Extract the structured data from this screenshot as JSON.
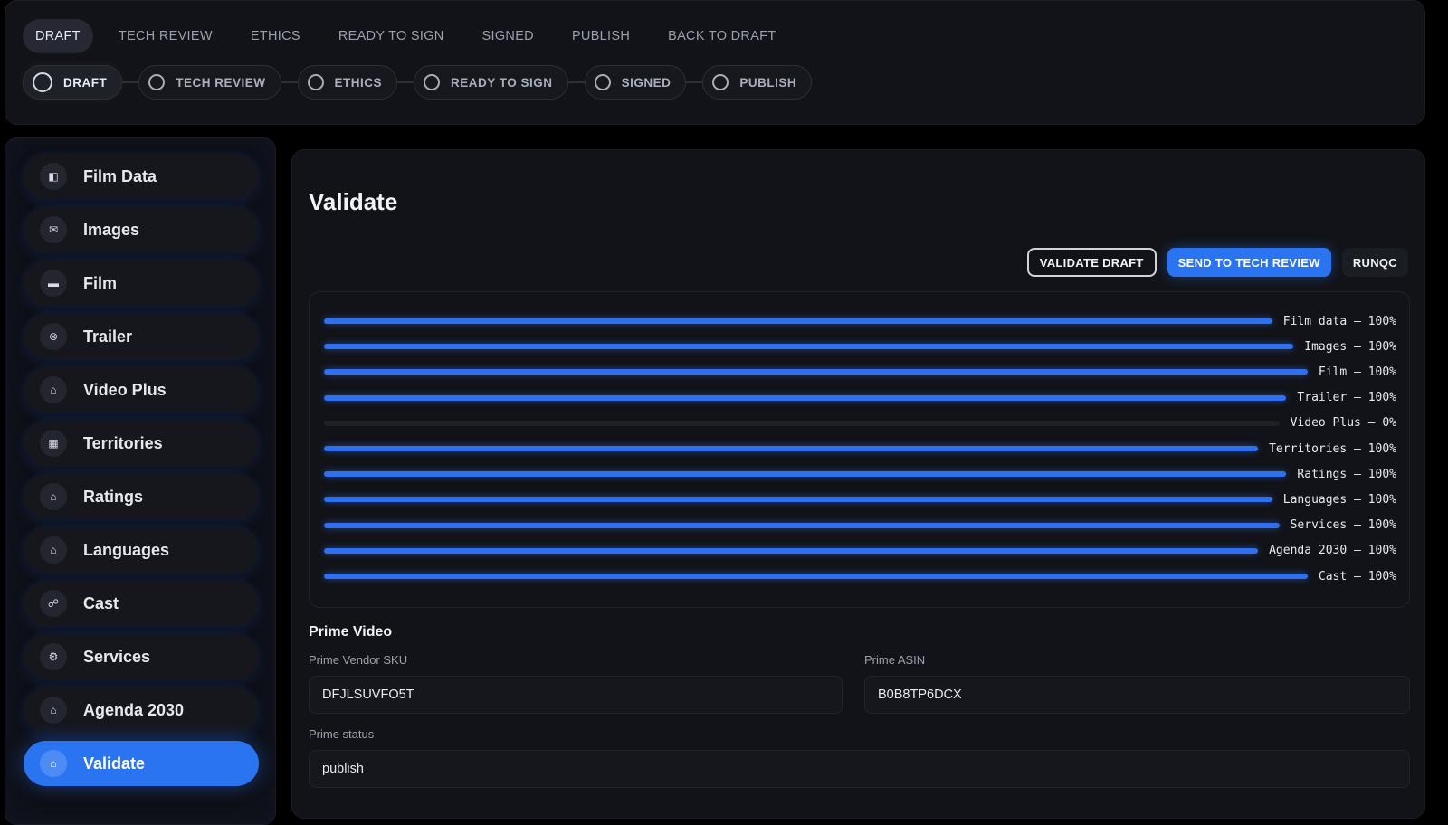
{
  "tabs": [
    {
      "label": "DRAFT",
      "active": true
    },
    {
      "label": "TECH REVIEW",
      "active": false
    },
    {
      "label": "ETHICS",
      "active": false
    },
    {
      "label": "READY TO SIGN",
      "active": false
    },
    {
      "label": "SIGNED",
      "active": false
    },
    {
      "label": "PUBLISH",
      "active": false
    },
    {
      "label": "BACK TO DRAFT",
      "active": false
    }
  ],
  "steps": [
    {
      "label": "DRAFT",
      "active": true
    },
    {
      "label": "TECH REVIEW",
      "active": false
    },
    {
      "label": "ETHICS",
      "active": false
    },
    {
      "label": "READY TO SIGN",
      "active": false
    },
    {
      "label": "SIGNED",
      "active": false
    },
    {
      "label": "PUBLISH",
      "active": false
    }
  ],
  "sidebar": {
    "items": [
      {
        "label": "Film Data",
        "icon": "film-data-icon",
        "glyph": "◧"
      },
      {
        "label": "Images",
        "icon": "images-icon",
        "glyph": "✉"
      },
      {
        "label": "Film",
        "icon": "film-icon",
        "glyph": "▬"
      },
      {
        "label": "Trailer",
        "icon": "trailer-icon",
        "glyph": "⊗"
      },
      {
        "label": "Video Plus",
        "icon": "home-icon",
        "glyph": "⌂"
      },
      {
        "label": "Territories",
        "icon": "calendar-icon",
        "glyph": "▦"
      },
      {
        "label": "Ratings",
        "icon": "home-icon",
        "glyph": "⌂"
      },
      {
        "label": "Languages",
        "icon": "home-icon",
        "glyph": "⌂"
      },
      {
        "label": "Cast",
        "icon": "users-icon",
        "glyph": "☍"
      },
      {
        "label": "Services",
        "icon": "gear-icon",
        "glyph": "⚙"
      },
      {
        "label": "Agenda 2030",
        "icon": "home-icon",
        "glyph": "⌂"
      },
      {
        "label": "Validate",
        "icon": "home-icon",
        "glyph": "⌂",
        "active": true
      }
    ]
  },
  "main": {
    "title": "Validate",
    "actions": {
      "validate_draft": "VALIDATE DRAFT",
      "send_to_tech_review": "SEND TO TECH REVIEW",
      "runqc": "RUNQC"
    },
    "progress": [
      {
        "label": "Film data — 100%",
        "value": 100
      },
      {
        "label": "Images — 100%",
        "value": 100
      },
      {
        "label": "Film — 100%",
        "value": 100
      },
      {
        "label": "Trailer — 100%",
        "value": 100
      },
      {
        "label": "Video Plus — 0%",
        "value": 0
      },
      {
        "label": "Territories — 100%",
        "value": 100
      },
      {
        "label": "Ratings — 100%",
        "value": 100
      },
      {
        "label": "Languages — 100%",
        "value": 100
      },
      {
        "label": "Services — 100%",
        "value": 100
      },
      {
        "label": "Agenda 2030 — 100%",
        "value": 100
      },
      {
        "label": "Cast — 100%",
        "value": 100
      }
    ],
    "prime": {
      "section_title": "Prime Video",
      "vendor_sku_label": "Prime Vendor SKU",
      "vendor_sku_value": "DFJLSUVFO5T",
      "asin_label": "Prime ASIN",
      "asin_value": "B0B8TP6DCX",
      "status_label": "Prime status",
      "status_value": "publish"
    }
  },
  "colors": {
    "accent": "#2a74f2",
    "progress": "#2f6ff0",
    "panel": "#121318"
  }
}
